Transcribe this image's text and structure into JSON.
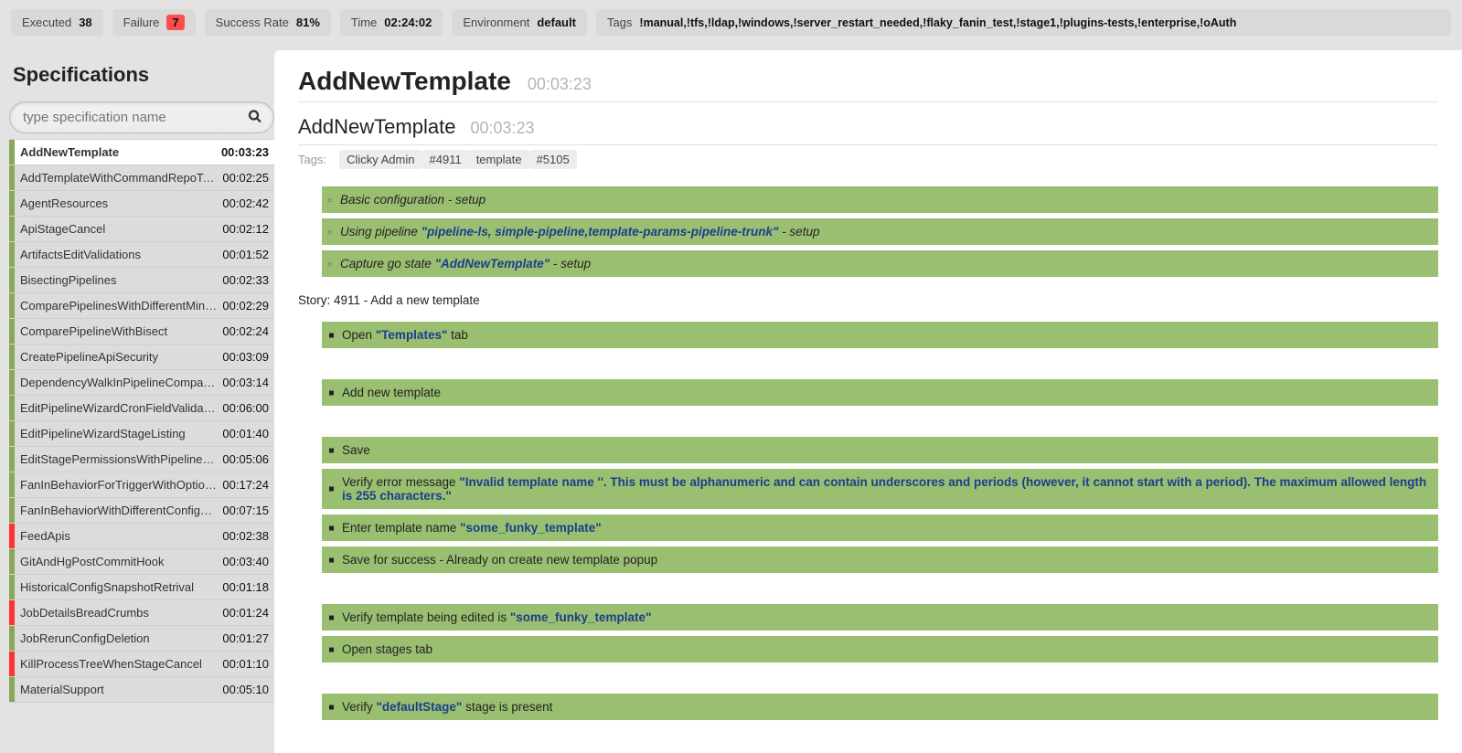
{
  "summary": {
    "executed_label": "Executed",
    "executed": "38",
    "failure_label": "Failure",
    "failure": "7",
    "success_label": "Success Rate",
    "success": "81%",
    "time_label": "Time",
    "time": "02:24:02",
    "env_label": "Environment",
    "env": "default",
    "tags_label": "Tags",
    "tags": "!manual,!tfs,!ldap,!windows,!server_restart_needed,!flaky_fanin_test,!stage1,!plugins-tests,!enterprise,!oAuth"
  },
  "sidebar": {
    "title": "Specifications",
    "search_placeholder": "type specification name",
    "items": [
      {
        "name": "AddNewTemplate",
        "time": "00:03:23",
        "status": "pass",
        "selected": true
      },
      {
        "name": "AddTemplateWithCommandRepoTask",
        "time": "00:02:25",
        "status": "pass"
      },
      {
        "name": "AgentResources",
        "time": "00:02:42",
        "status": "pass"
      },
      {
        "name": "ApiStageCancel",
        "time": "00:02:12",
        "status": "pass"
      },
      {
        "name": "ArtifactsEditValidations",
        "time": "00:01:52",
        "status": "pass"
      },
      {
        "name": "BisectingPipelines",
        "time": "00:02:33",
        "status": "pass"
      },
      {
        "name": "ComparePipelinesWithDifferentMing…",
        "time": "00:02:29",
        "status": "pass"
      },
      {
        "name": "ComparePipelineWithBisect",
        "time": "00:02:24",
        "status": "pass"
      },
      {
        "name": "CreatePipelineApiSecurity",
        "time": "00:03:09",
        "status": "pass"
      },
      {
        "name": "DependencyWalkInPipelineCompar…",
        "time": "00:03:14",
        "status": "pass"
      },
      {
        "name": "EditPipelineWizardCronFieldValidati…",
        "time": "00:06:00",
        "status": "pass"
      },
      {
        "name": "EditPipelineWizardStageListing",
        "time": "00:01:40",
        "status": "pass"
      },
      {
        "name": "EditStagePermissionsWithPipelineG…",
        "time": "00:05:06",
        "status": "pass"
      },
      {
        "name": "FanInBehaviorForTriggerWithOptions",
        "time": "00:17:24",
        "status": "pass"
      },
      {
        "name": "FanInBehaviorWithDifferentConfigur…",
        "time": "00:07:15",
        "status": "pass"
      },
      {
        "name": "FeedApis",
        "time": "00:02:38",
        "status": "fail"
      },
      {
        "name": "GitAndHgPostCommitHook",
        "time": "00:03:40",
        "status": "pass"
      },
      {
        "name": "HistoricalConfigSnapshotRetrival",
        "time": "00:01:18",
        "status": "pass"
      },
      {
        "name": "JobDetailsBreadCrumbs",
        "time": "00:01:24",
        "status": "fail"
      },
      {
        "name": "JobRerunConfigDeletion",
        "time": "00:01:27",
        "status": "pass"
      },
      {
        "name": "KillProcessTreeWhenStageCancel",
        "time": "00:01:10",
        "status": "fail"
      },
      {
        "name": "MaterialSupport",
        "time": "00:05:10",
        "status": "pass"
      }
    ]
  },
  "detail": {
    "title": "AddNewTemplate",
    "time": "00:03:23",
    "subtitle": "AddNewTemplate",
    "subtime": "00:03:23",
    "tags_label": "Tags:",
    "tags": [
      "Clicky Admin",
      "#4911",
      "template",
      "#5105"
    ],
    "contexts": [
      {
        "pre": "Basic configuration - setup"
      },
      {
        "pre": "Using pipeline ",
        "q": "\"pipeline-ls, simple-pipeline,template-params-pipeline-trunk\"",
        "post": " - setup"
      },
      {
        "pre": "Capture go state ",
        "q": "\"AddNewTemplate\"",
        "post": " - setup"
      }
    ],
    "story": "Story: 4911 - Add a new template",
    "steps": [
      {
        "pre": "Open ",
        "q": "\"Templates\"",
        "post": " tab",
        "gap": true
      },
      {
        "pre": "Add new template",
        "gap": true
      },
      {
        "pre": "Save"
      },
      {
        "pre": "Verify error message ",
        "q": "\"Invalid template name ''. This must be alphanumeric and can contain underscores and periods (however, it cannot start with a period). The maximum allowed length is 255 characters.\""
      },
      {
        "pre": "Enter template name ",
        "q": "\"some_funky_template\""
      },
      {
        "pre": "Save for success - Already on create new template popup",
        "gap": true
      },
      {
        "pre": "Verify template being edited is ",
        "q": "\"some_funky_template\""
      },
      {
        "pre": "Open stages tab",
        "gap": true
      },
      {
        "pre": "Verify ",
        "q": "\"defaultStage\"",
        "post": " stage is present"
      }
    ]
  }
}
